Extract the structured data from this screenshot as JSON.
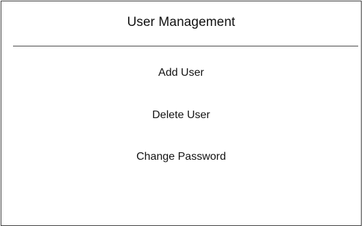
{
  "window": {
    "title": "User Management"
  },
  "menu": {
    "items": [
      {
        "label": "Add User"
      },
      {
        "label": "Delete User"
      },
      {
        "label": "Change Password"
      }
    ]
  },
  "colors": {
    "border": "#3a3a3a",
    "divider": "#444444",
    "text": "#111111",
    "background": "#ffffff"
  }
}
